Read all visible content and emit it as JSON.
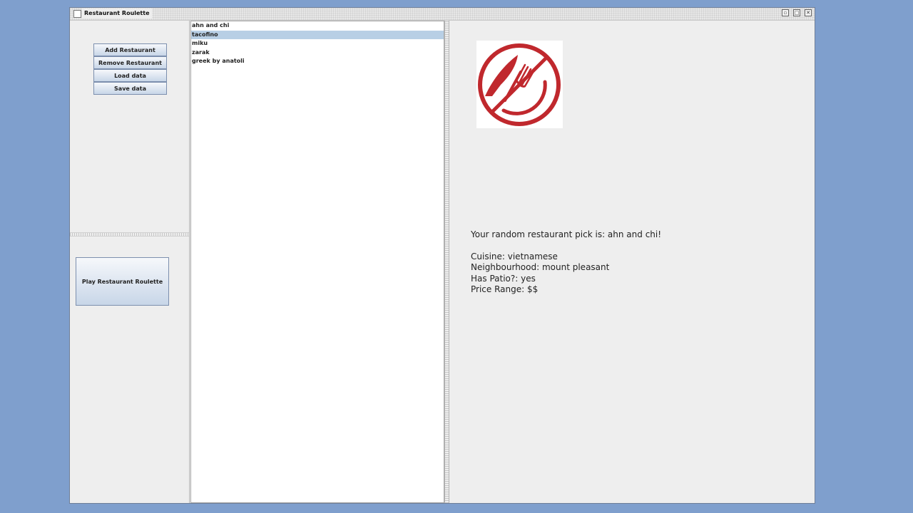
{
  "window": {
    "title": "Restaurant Roulette",
    "controls": [
      "minimize-icon",
      "maximize-icon",
      "close-icon"
    ]
  },
  "left_panel": {
    "buttons": {
      "add": "Add Restaurant",
      "remove": "Remove Restaurant",
      "load": "Load data",
      "save": "Save data"
    },
    "play_button": "Play Restaurant Roulette"
  },
  "restaurant_list": {
    "items": [
      "ahn and chi",
      "tacofino",
      "miku",
      "zarak",
      "greek by anatoli"
    ],
    "selected_index": 1
  },
  "result": {
    "pick": "Your random restaurant pick is: ahn and chi!",
    "cuisine": "Cuisine: vietnamese",
    "neighbourhood": "Neighbourhood: mount pleasant",
    "patio": "Has Patio?: yes",
    "price": "Price Range: $$"
  },
  "logo": {
    "icon": "plate-knife-fork-icon",
    "color": "#c0282d"
  },
  "colors": {
    "desktop": "#7f9fcd",
    "selection": "#b8cfe5"
  }
}
